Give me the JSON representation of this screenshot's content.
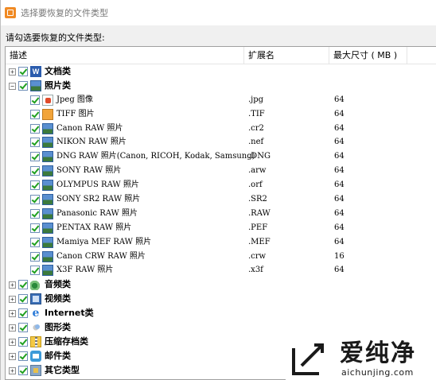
{
  "window": {
    "title": "选择要恢复的文件类型"
  },
  "prompt": "请勾选要恢复的文件类型:",
  "columns": {
    "desc": "描述",
    "ext": "扩展名",
    "size": "最大尺寸 ( MB )"
  },
  "rows": [
    {
      "kind": "cat",
      "expander": "+",
      "icon": "word-icon",
      "label": "文档类",
      "ext": "",
      "size": ""
    },
    {
      "kind": "cat",
      "expander": "−",
      "icon": "photo-icon",
      "label": "照片类",
      "ext": "",
      "size": ""
    },
    {
      "kind": "sub",
      "icon": "jpeg-icon",
      "label": "Jpeg 图像",
      "ext": ".jpg",
      "size": "64"
    },
    {
      "kind": "sub",
      "icon": "tiff-icon",
      "label": "TIFF 图片",
      "ext": ".TIF",
      "size": "64"
    },
    {
      "kind": "sub",
      "icon": "photo-icon",
      "label": "Canon RAW 照片",
      "ext": ".cr2",
      "size": "64"
    },
    {
      "kind": "sub",
      "icon": "photo-icon",
      "label": "NIKON RAW 照片",
      "ext": ".nef",
      "size": "64"
    },
    {
      "kind": "sub",
      "icon": "photo-icon",
      "label": "DNG RAW 照片(Canon, RICOH, Kodak, Samsung)",
      "ext": ".DNG",
      "size": "64"
    },
    {
      "kind": "sub",
      "icon": "photo-icon",
      "label": "SONY RAW 照片",
      "ext": ".arw",
      "size": "64"
    },
    {
      "kind": "sub",
      "icon": "photo-icon",
      "label": "OLYMPUS RAW 照片",
      "ext": ".orf",
      "size": "64"
    },
    {
      "kind": "sub",
      "icon": "photo-icon",
      "label": "SONY SR2 RAW 照片",
      "ext": ".SR2",
      "size": "64"
    },
    {
      "kind": "sub",
      "icon": "photo-icon",
      "label": "Panasonic RAW 照片",
      "ext": ".RAW",
      "size": "64"
    },
    {
      "kind": "sub",
      "icon": "photo-icon",
      "label": "PENTAX RAW 照片",
      "ext": ".PEF",
      "size": "64"
    },
    {
      "kind": "sub",
      "icon": "photo-icon",
      "label": "Mamiya MEF RAW 照片",
      "ext": ".MEF",
      "size": "64"
    },
    {
      "kind": "sub",
      "icon": "photo-icon",
      "label": "Canon CRW RAW 照片",
      "ext": ".crw",
      "size": "16"
    },
    {
      "kind": "sub",
      "icon": "photo-icon",
      "label": "X3F RAW 照片",
      "ext": ".x3f",
      "size": "64"
    },
    {
      "kind": "cat",
      "expander": "+",
      "icon": "audio-icon",
      "label": "音频类",
      "ext": "",
      "size": ""
    },
    {
      "kind": "cat",
      "expander": "+",
      "icon": "video-icon",
      "label": "视频类",
      "ext": "",
      "size": ""
    },
    {
      "kind": "cat",
      "expander": "+",
      "icon": "internet-icon",
      "label": "Internet类",
      "ext": "",
      "size": ""
    },
    {
      "kind": "cat",
      "expander": "+",
      "icon": "graphics-icon",
      "label": "图形类",
      "ext": "",
      "size": ""
    },
    {
      "kind": "cat",
      "expander": "+",
      "icon": "archive-icon",
      "label": "压缩存档类",
      "ext": "",
      "size": ""
    },
    {
      "kind": "cat",
      "expander": "+",
      "icon": "mail-icon",
      "label": "邮件类",
      "ext": "",
      "size": ""
    },
    {
      "kind": "cat",
      "expander": "+",
      "icon": "other-icon",
      "label": "其它类型",
      "ext": "",
      "size": ""
    }
  ],
  "watermark": {
    "cn": "爱纯净",
    "en": "aichunjing.com",
    "color": "#1a1a1a"
  }
}
